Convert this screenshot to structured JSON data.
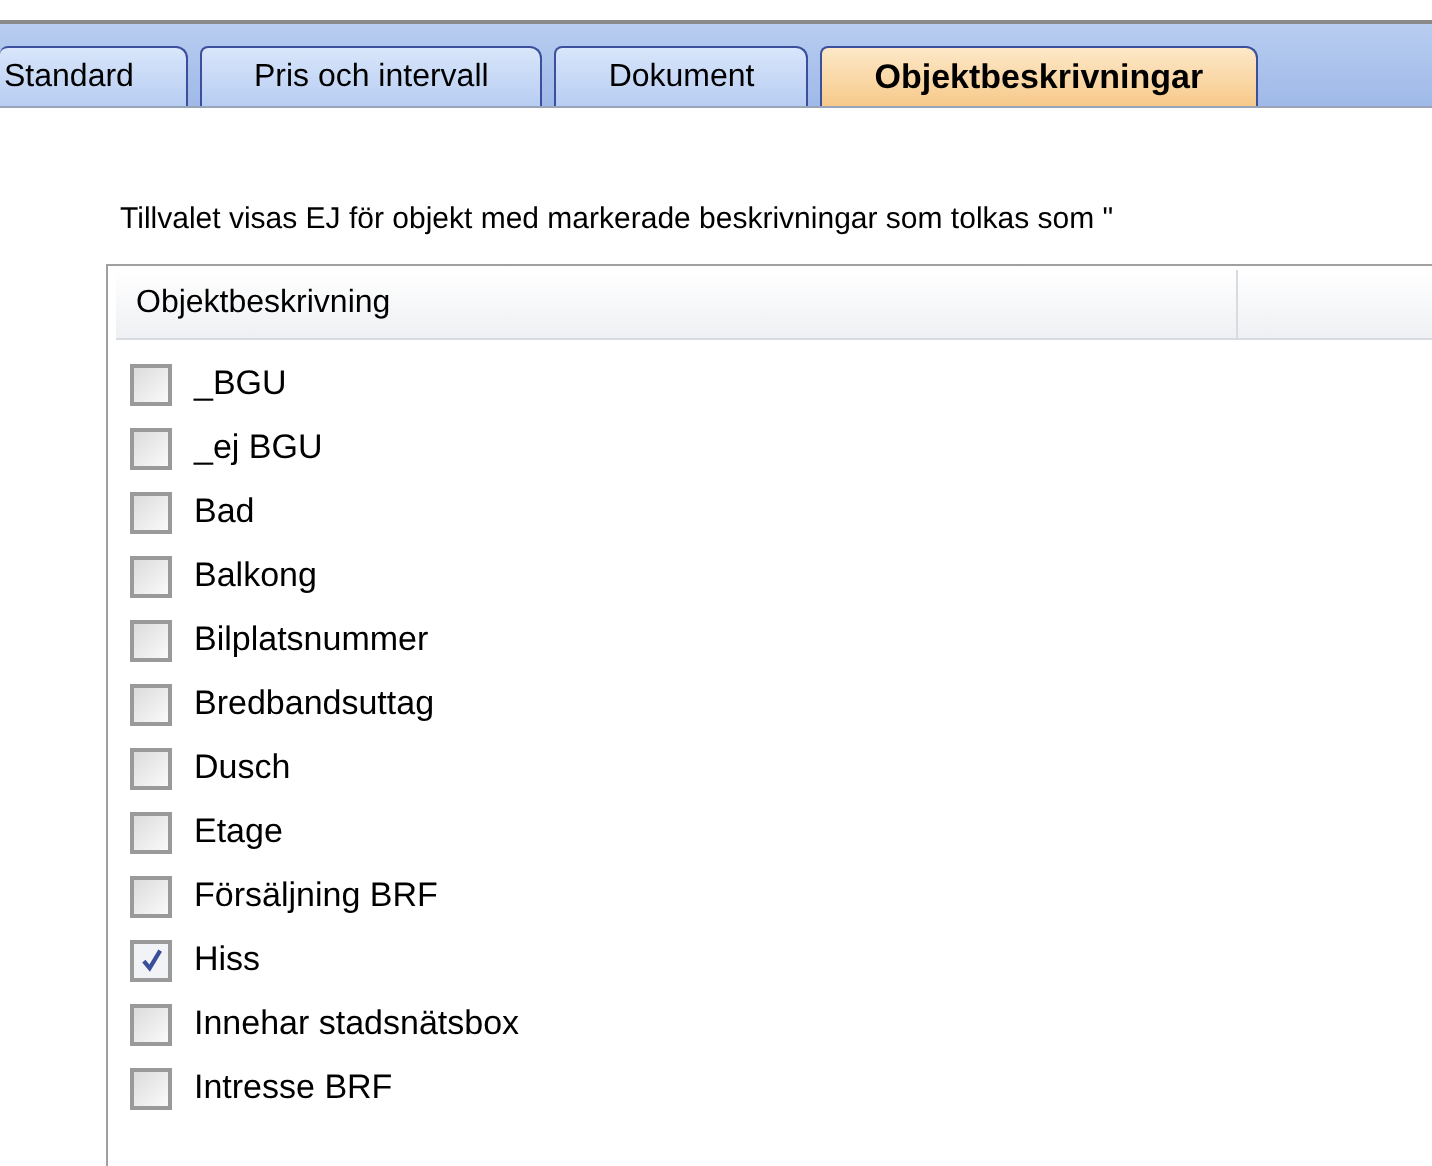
{
  "tabs": [
    {
      "label": "Standard",
      "selected": false
    },
    {
      "label": "Pris och intervall",
      "selected": false
    },
    {
      "label": "Dokument",
      "selected": false
    },
    {
      "label": "Objektbeskrivningar",
      "selected": true
    }
  ],
  "instruction": "Tillvalet visas EJ för objekt med markerade beskrivningar som tolkas som \"",
  "table": {
    "columns": [
      "Objektbeskrivning"
    ],
    "rows": [
      {
        "label": "_BGU",
        "checked": false
      },
      {
        "label": "_ej BGU",
        "checked": false
      },
      {
        "label": "Bad",
        "checked": false
      },
      {
        "label": "Balkong",
        "checked": false
      },
      {
        "label": "Bilplatsnummer",
        "checked": false
      },
      {
        "label": "Bredbandsuttag",
        "checked": false
      },
      {
        "label": "Dusch",
        "checked": false
      },
      {
        "label": "Etage",
        "checked": false
      },
      {
        "label": "Försäljning BRF",
        "checked": false
      },
      {
        "label": "Hiss",
        "checked": true
      },
      {
        "label": "Innehar stadsnätsbox",
        "checked": false
      },
      {
        "label": "Intresse BRF",
        "checked": false
      }
    ]
  }
}
